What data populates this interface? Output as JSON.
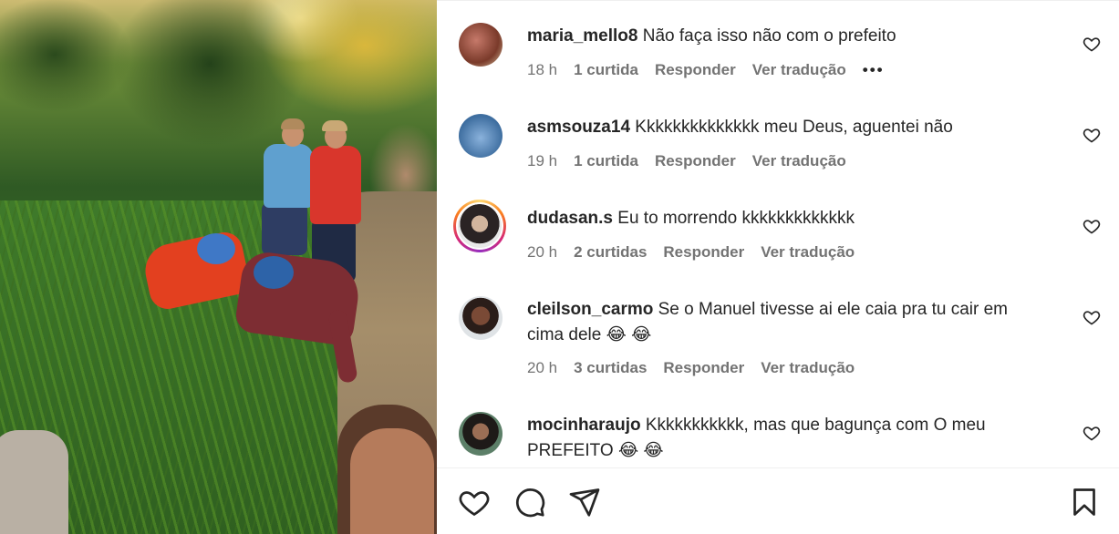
{
  "post": {
    "image_alt": "Pessoas caídas na beira de um riacho na mata"
  },
  "comments": [
    {
      "username": "maria_mello8",
      "text": "Não faça isso não com o prefeito",
      "time": "18 h",
      "likes": "1 curtida",
      "reply": "Responder",
      "translate": "Ver tradução",
      "more": "•••",
      "story_ring": false
    },
    {
      "username": "asmsouza14",
      "text": "Kkkkkkkkkkkkkk meu Deus, aguentei não",
      "time": "19 h",
      "likes": "1 curtida",
      "reply": "Responder",
      "translate": "Ver tradução",
      "story_ring": false
    },
    {
      "username": "dudasan.s",
      "text": "Eu to morrendo kkkkkkkkkkkkk",
      "time": "20 h",
      "likes": "2 curtidas",
      "reply": "Responder",
      "translate": "Ver tradução",
      "story_ring": true
    },
    {
      "username": "cleilson_carmo",
      "text": "Se o Manuel tivesse ai ele caia pra tu cair em cima dele 😂 😂",
      "time": "20 h",
      "likes": "3 curtidas",
      "reply": "Responder",
      "translate": "Ver tradução",
      "story_ring": false
    },
    {
      "username": "mocinharaujo",
      "text": "Kkkkkkkkkkk, mas que bagunça com O meu PREFEITO 😂 😂",
      "time": "",
      "likes": "",
      "reply": "",
      "translate": "",
      "story_ring": false
    }
  ],
  "actions": {
    "like_icon": "heart-icon",
    "comment_icon": "comment-icon",
    "share_icon": "share-icon",
    "save_icon": "bookmark-icon"
  },
  "colors": {
    "text": "#262626",
    "muted": "#737373",
    "border": "#efefef"
  }
}
